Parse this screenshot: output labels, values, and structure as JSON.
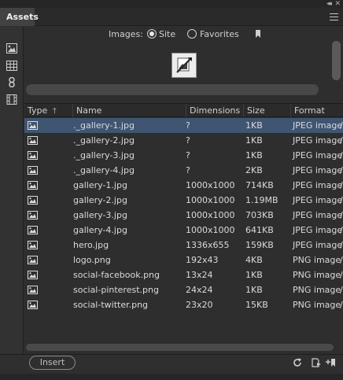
{
  "panel": {
    "tab_label": "Assets"
  },
  "filter": {
    "label": "Images:",
    "option_site": "Site",
    "option_favorites": "Favorites",
    "selected": "Site"
  },
  "sidebar_icons": [
    "image-category-icon",
    "colors-category-icon",
    "links-category-icon",
    "media-category-icon"
  ],
  "table": {
    "columns": [
      "Type",
      "Name",
      "Dimensions",
      "Size",
      "Format"
    ],
    "sort_column": "Type",
    "rows": [
      {
        "name": "._gallery-1.jpg",
        "dimensions": "?",
        "size": "1KB",
        "format": "JPEG image",
        "extra": "/",
        "selected": true
      },
      {
        "name": "._gallery-2.jpg",
        "dimensions": "?",
        "size": "1KB",
        "format": "JPEG image",
        "extra": "/"
      },
      {
        "name": "._gallery-3.jpg",
        "dimensions": "?",
        "size": "1KB",
        "format": "JPEG image",
        "extra": "/"
      },
      {
        "name": "._gallery-4.jpg",
        "dimensions": "?",
        "size": "2KB",
        "format": "JPEG image",
        "extra": "/"
      },
      {
        "name": "gallery-1.jpg",
        "dimensions": "1000x1000",
        "size": "714KB",
        "format": "JPEG image",
        "extra": "/"
      },
      {
        "name": "gallery-2.jpg",
        "dimensions": "1000x1000",
        "size": "1.19MB",
        "format": "JPEG image",
        "extra": "/"
      },
      {
        "name": "gallery-3.jpg",
        "dimensions": "1000x1000",
        "size": "703KB",
        "format": "JPEG image",
        "extra": "/"
      },
      {
        "name": "gallery-4.jpg",
        "dimensions": "1000x1000",
        "size": "641KB",
        "format": "JPEG image",
        "extra": "/"
      },
      {
        "name": "hero.jpg",
        "dimensions": "1336x655",
        "size": "159KB",
        "format": "JPEG image",
        "extra": "/"
      },
      {
        "name": "logo.png",
        "dimensions": "192x43",
        "size": "4KB",
        "format": "PNG image",
        "extra": "/"
      },
      {
        "name": "social-facebook.png",
        "dimensions": "13x24",
        "size": "1KB",
        "format": "PNG image",
        "extra": "/"
      },
      {
        "name": "social-pinterest.png",
        "dimensions": "24x24",
        "size": "1KB",
        "format": "PNG image",
        "extra": "/"
      },
      {
        "name": "social-twitter.png",
        "dimensions": "23x20",
        "size": "15KB",
        "format": "PNG image",
        "extra": "/"
      }
    ]
  },
  "footer": {
    "insert_label": "Insert"
  }
}
